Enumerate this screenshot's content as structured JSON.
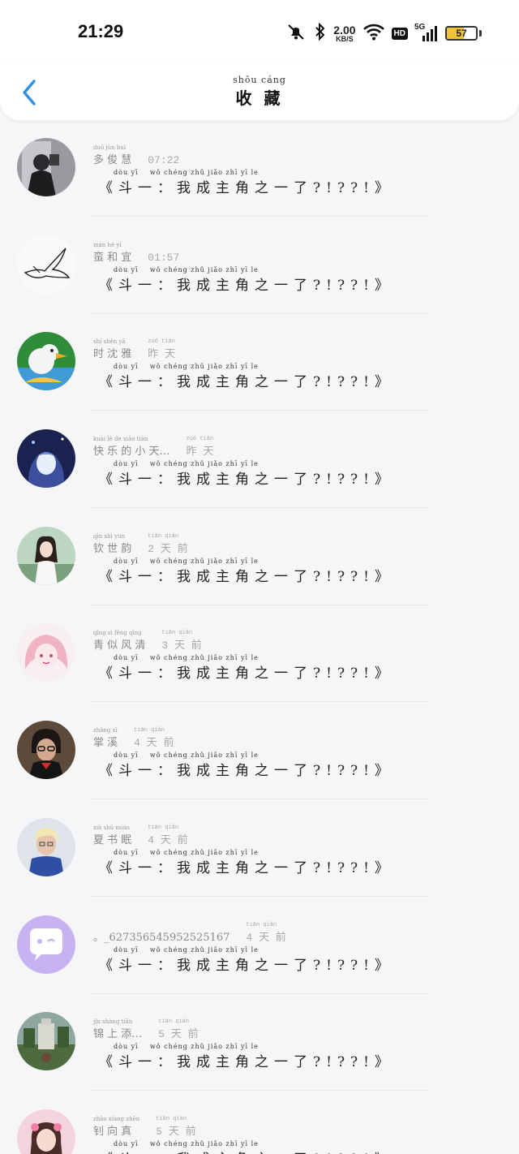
{
  "status_bar": {
    "time": "21:29",
    "net_speed_value": "2.00",
    "net_speed_unit": "KB/S",
    "hd": "HD",
    "network": "5G",
    "battery": "57",
    "battery_fill": 0.57,
    "icons": [
      "mute-bell-icon",
      "bluetooth-icon",
      "wifi-icon",
      "signal-icon",
      "battery-icon"
    ]
  },
  "header": {
    "title_pinyin": "shōu cáng",
    "title": "收 藏",
    "back_icon": "chevron-left-icon"
  },
  "items": [
    {
      "name_pinyin": "duō jùn huì",
      "name": "多 俊 慧",
      "time_pinyin": "",
      "time": "07:22",
      "content_pinyin": "dòu yī    wǒ chéng zhǔ jiǎo zhī yī le",
      "content": "《斗一：我成主角之一了?!??!》",
      "avatar": "mirror-selfie-photo"
    },
    {
      "name_pinyin": "mán hé yí",
      "name": "蛮 和 宜",
      "time_pinyin": "",
      "time": "01:57",
      "content_pinyin": "dòu yī    wǒ chéng zhǔ jiǎo zhī yī le",
      "content": "《斗一：我成主角之一了?!??!》",
      "avatar": "dove-sketch"
    },
    {
      "name_pinyin": "shí shěn yǎ",
      "name": "时 沈 雅",
      "time_pinyin": "zuó tiān",
      "time": "昨 天",
      "content_pinyin": "dòu yī    wǒ chéng zhǔ jiǎo zhī yī le",
      "content": "《斗一：我成主角之一了?!??!》",
      "avatar": "cartoon-duck"
    },
    {
      "name_pinyin": "kuài lè de xiǎo tiān",
      "name": "快 乐 的 小 天…",
      "time_pinyin": "zuó tiān",
      "time": "昨 天",
      "content_pinyin": "dòu yī    wǒ chéng zhǔ jiǎo zhī yī le",
      "content": "《斗一：我成主角之一了?!??!》",
      "avatar": "anime-girl-blue"
    },
    {
      "name_pinyin": "qīn shì yùn",
      "name": "钦 世 韵",
      "time_pinyin": "tiān qián",
      "time": "2 天 前",
      "content_pinyin": "dòu yī    wǒ chéng zhǔ jiǎo zhī yī le",
      "content": "《斗一：我成主角之一了?!??!》",
      "avatar": "woman-outdoor-photo"
    },
    {
      "name_pinyin": "qīng sì fēng qīng",
      "name": "青 似 风 清",
      "time_pinyin": "tiān qián",
      "time": "3 天 前",
      "content_pinyin": "dòu yī    wǒ chéng zhǔ jiǎo zhī yī le",
      "content": "《斗一：我成主角之一了?!??!》",
      "avatar": "anime-girl-pink"
    },
    {
      "name_pinyin": "zhǎng xī",
      "name": "掌 溪",
      "time_pinyin": "tiān qián",
      "time": "4 天 前",
      "content_pinyin": "dòu yī    wǒ chéng zhǔ jiǎo zhī yī le",
      "content": "《斗一：我成主角之一了?!??!》",
      "avatar": "woman-glasses-photo"
    },
    {
      "name_pinyin": "xià shū mián",
      "name": "夏 书 眠",
      "time_pinyin": "tiān qián",
      "time": "4 天 前",
      "content_pinyin": "dòu yī    wǒ chéng zhǔ jiǎo zhī yī le",
      "content": "《斗一：我成主角之一了?!??!》",
      "avatar": "blonde-person-photo"
    },
    {
      "name_pinyin": "",
      "name": "。_627356545952525167",
      "time_pinyin": "tiān qián",
      "time": "4 天 前",
      "content_pinyin": "dòu yī    wǒ chéng zhǔ jiǎo zhī yī le",
      "content": "《斗一：我成主角之一了?!??!》",
      "avatar": "chat-bubble-icon"
    },
    {
      "name_pinyin": "jǐn shàng tiān",
      "name": "锦 上 添…",
      "time_pinyin": "tiān qián",
      "time": "5 天 前",
      "content_pinyin": "dòu yī    wǒ chéng zhǔ jiǎo zhī yī le",
      "content": "《斗一：我成主角之一了?!??!》",
      "avatar": "monument-photo"
    },
    {
      "name_pinyin": "zhāo xiàng zhēn",
      "name": "钊 向 真",
      "time_pinyin": "tiān qián",
      "time": "5 天 前",
      "content_pinyin": "dòu yī    wǒ chéng zhǔ jiǎo zhī yī le",
      "content": "《斗一：我成主角之一了?!??!》",
      "avatar": "girl-pink-photo"
    }
  ]
}
